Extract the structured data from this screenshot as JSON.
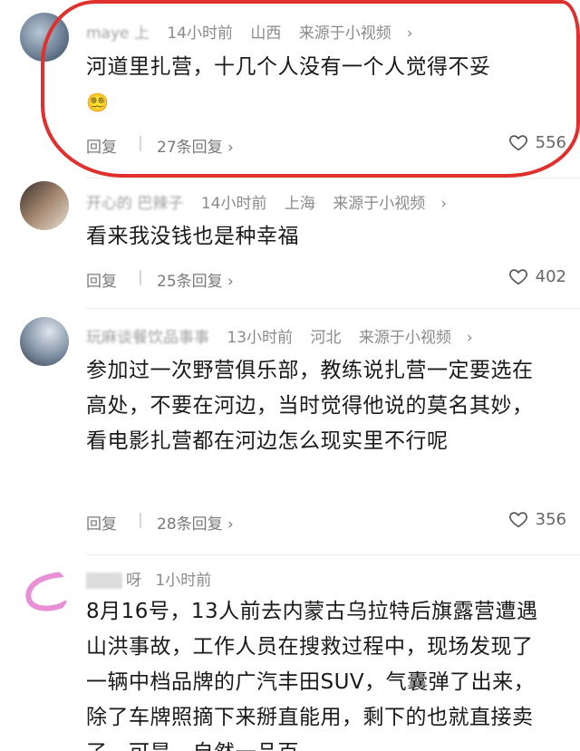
{
  "comments": [
    {
      "username": "maye 上",
      "time": "14小时前",
      "location": "山西",
      "source": "来源于小视频",
      "text": "河道里扎营，十几个人没有一个人觉得不妥",
      "emoji": "😵‍💫",
      "reply_label": "回复",
      "reply_count": "27条回复",
      "likes": "556"
    },
    {
      "username": "开心的 巴辣子",
      "time": "14小时前",
      "location": "上海",
      "source": "来源于小视频",
      "text": "看来我没钱也是种幸福",
      "reply_label": "回复",
      "reply_count": "25条回复",
      "likes": "402"
    },
    {
      "username": "玩麻谈餐饮品事事",
      "time": "13小时前",
      "location": "河北",
      "source": "来源于小视频",
      "text": "参加过一次野营俱乐部，教练说扎营一定要选在高处，不要在河边，当时觉得他说的莫名其妙，看电影扎营都在河边怎么现实里不行呢",
      "reply_label": "回复",
      "reply_count": "28条回复",
      "likes": "356"
    },
    {
      "username": "呀",
      "time": "1小时前",
      "text": "8月16号，13人前去内蒙古乌拉特后旗露营遭遇山洪事故，工作人员在搜救过程中，现场发现了一辆中档品牌的广汽丰田SUV，气囊弹了出来，除了车牌照摘下来掰直能用，剩下的也就直接卖了，可是，自然一品百"
    }
  ],
  "colors": {
    "highlight": "#e0302e",
    "meta": "#8a8a8a",
    "text": "#1a1a1a"
  }
}
